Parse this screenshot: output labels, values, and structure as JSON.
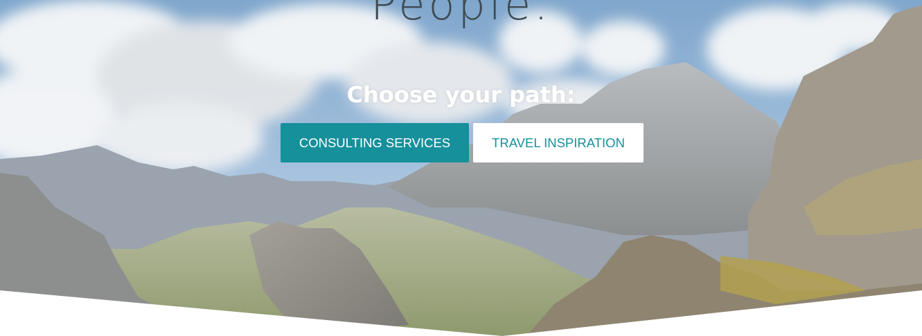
{
  "hero": {
    "headline": "People.",
    "subheading": "Choose your path:",
    "primary_button_label": "CONSULTING SERVICES",
    "secondary_button_label": "TRAVEL INSPIRATION",
    "background_image": "mountain-landscape"
  },
  "colors": {
    "accent": "#16909b",
    "headline": "#3d4a52",
    "page_background": "#ffffff"
  }
}
